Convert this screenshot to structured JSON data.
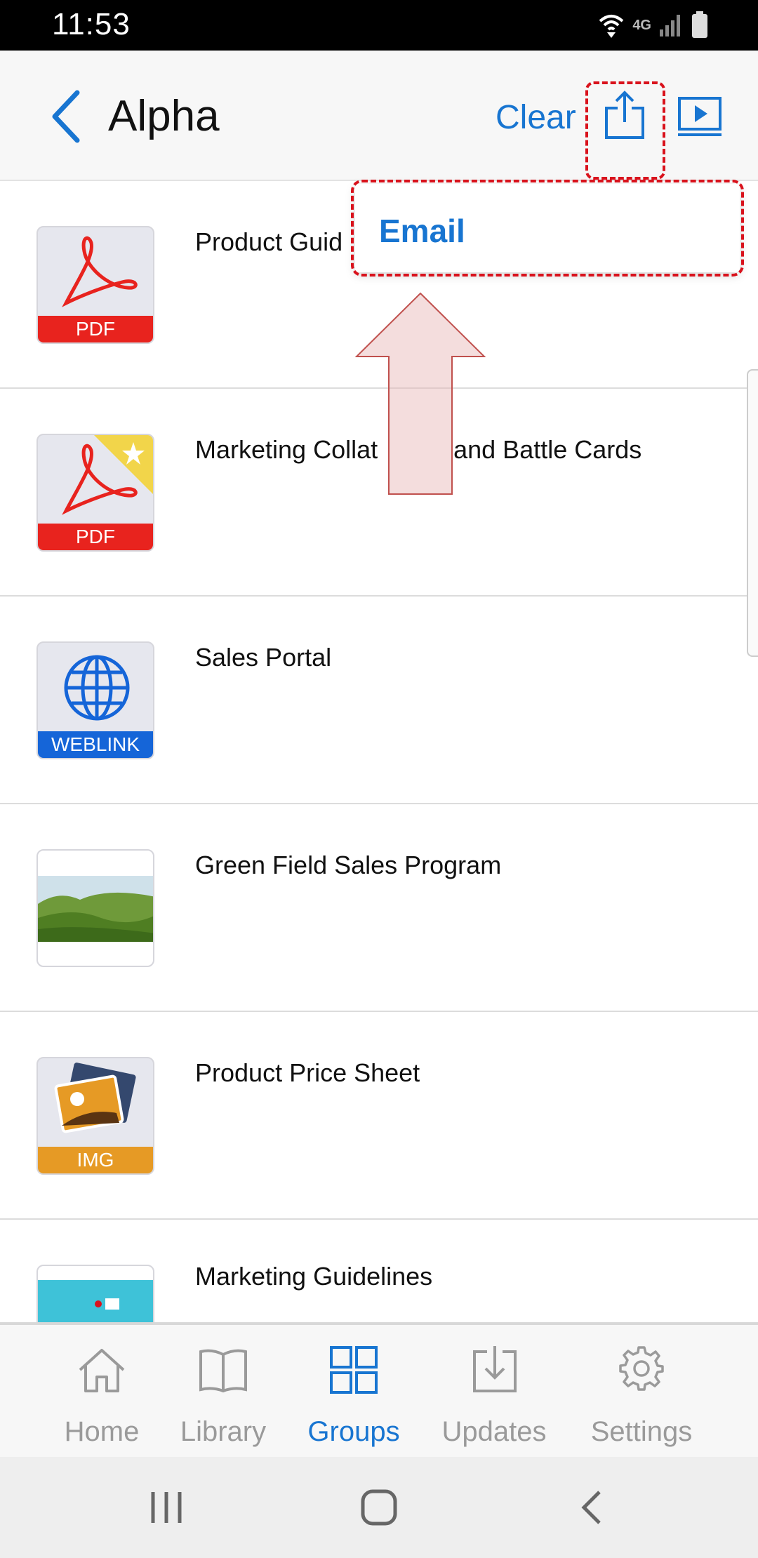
{
  "status_bar": {
    "time": "11:53",
    "network": "4G"
  },
  "header": {
    "title": "Alpha",
    "clear_label": "Clear"
  },
  "popup": {
    "email_label": "Email"
  },
  "items": [
    {
      "title": "Product Guid",
      "type": "PDF",
      "band": "PDF",
      "favorite": false
    },
    {
      "title": "Marketing Collat",
      "title_tail": "and Battle Cards",
      "type": "PDF",
      "band": "PDF",
      "favorite": true
    },
    {
      "title": "Sales Portal",
      "type": "WEBLINK",
      "band": "WEBLINK"
    },
    {
      "title": "Green Field Sales Program",
      "type": "image-landscape"
    },
    {
      "title": "Product Price Sheet",
      "type": "IMG",
      "band": "IMG"
    },
    {
      "title": "Marketing Guidelines",
      "type": "image-diagram"
    }
  ],
  "tabs": [
    {
      "label": "Home",
      "icon": "home-icon"
    },
    {
      "label": "Library",
      "icon": "book-icon"
    },
    {
      "label": "Groups",
      "icon": "grid-icon",
      "active": true
    },
    {
      "label": "Updates",
      "icon": "download-icon"
    },
    {
      "label": "Settings",
      "icon": "gear-icon"
    }
  ],
  "colors": {
    "accent": "#1875d1",
    "highlight": "#d9121c",
    "pdf_band": "#e8231e",
    "weblink_band": "#1565d8",
    "img_band": "#e69a25"
  }
}
